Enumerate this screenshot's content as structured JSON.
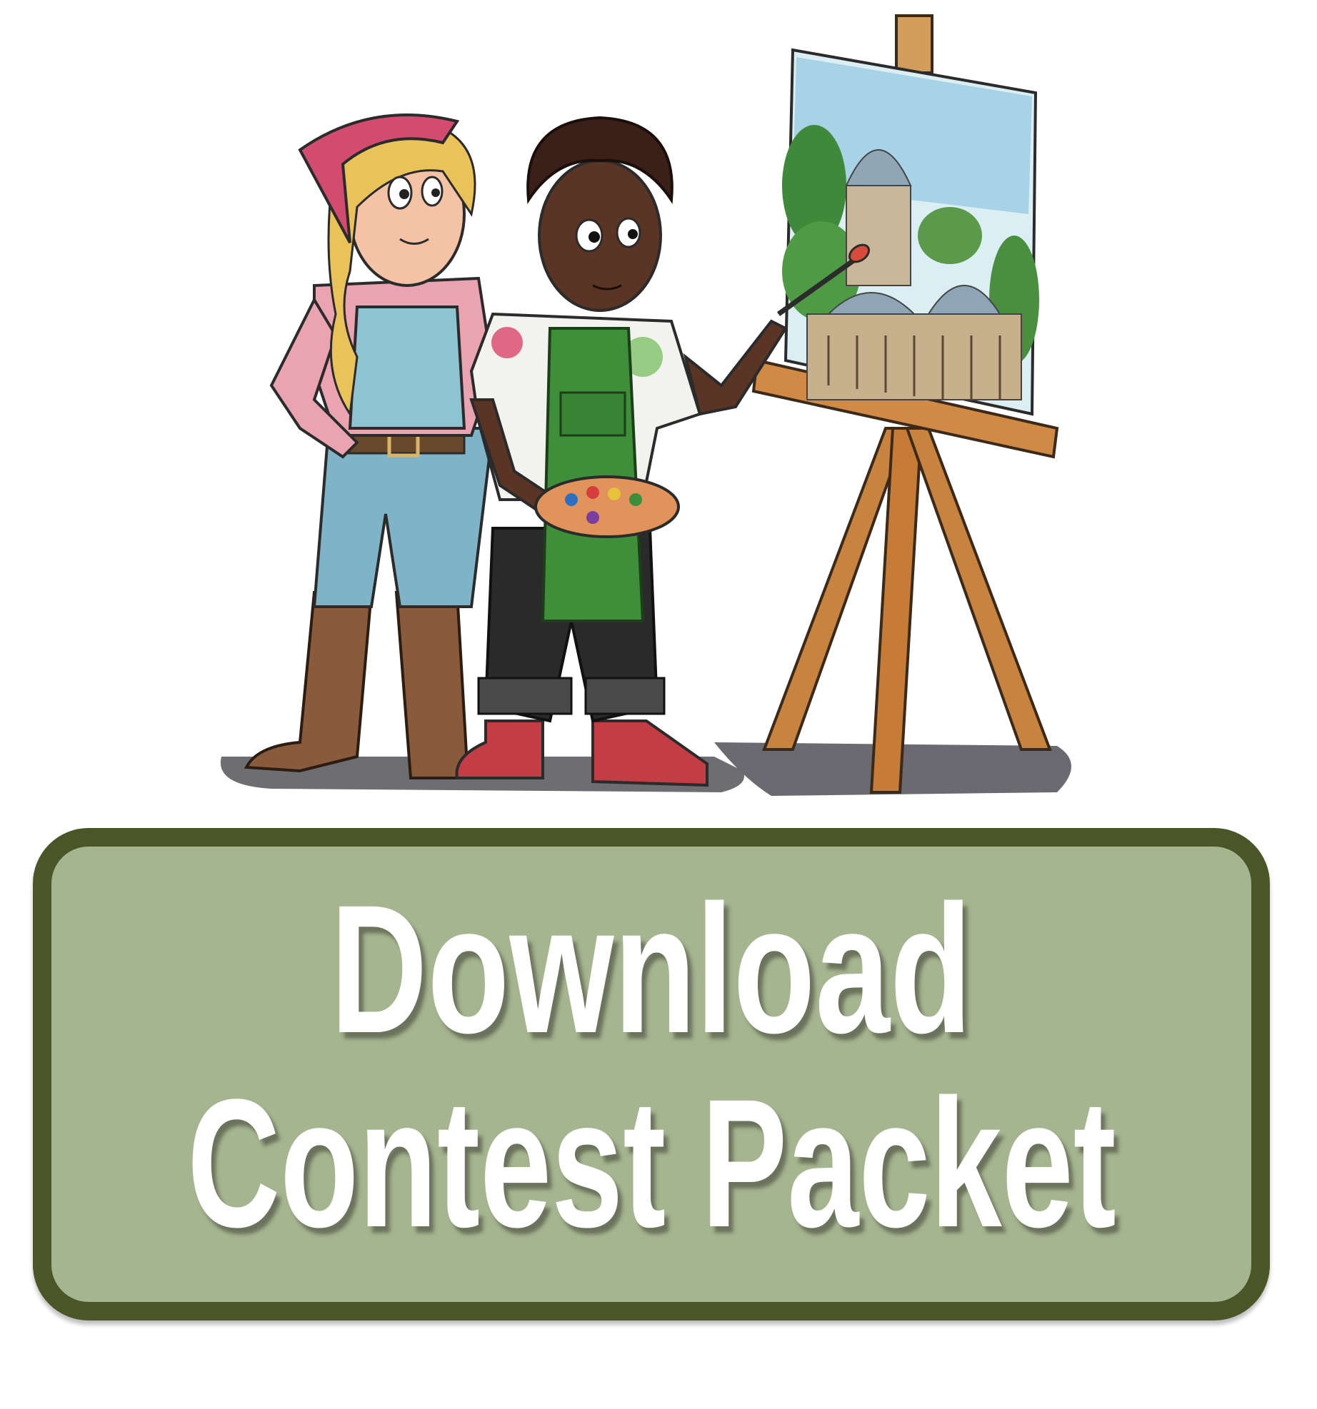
{
  "button": {
    "line1": "Download",
    "line2": "Contest Packet"
  },
  "illustration": {
    "subject": "watercolor-kids-painting-at-easel",
    "colors": {
      "button_fill": "#a5b590",
      "button_border": "#4a5528",
      "button_text": "#ffffff"
    }
  }
}
